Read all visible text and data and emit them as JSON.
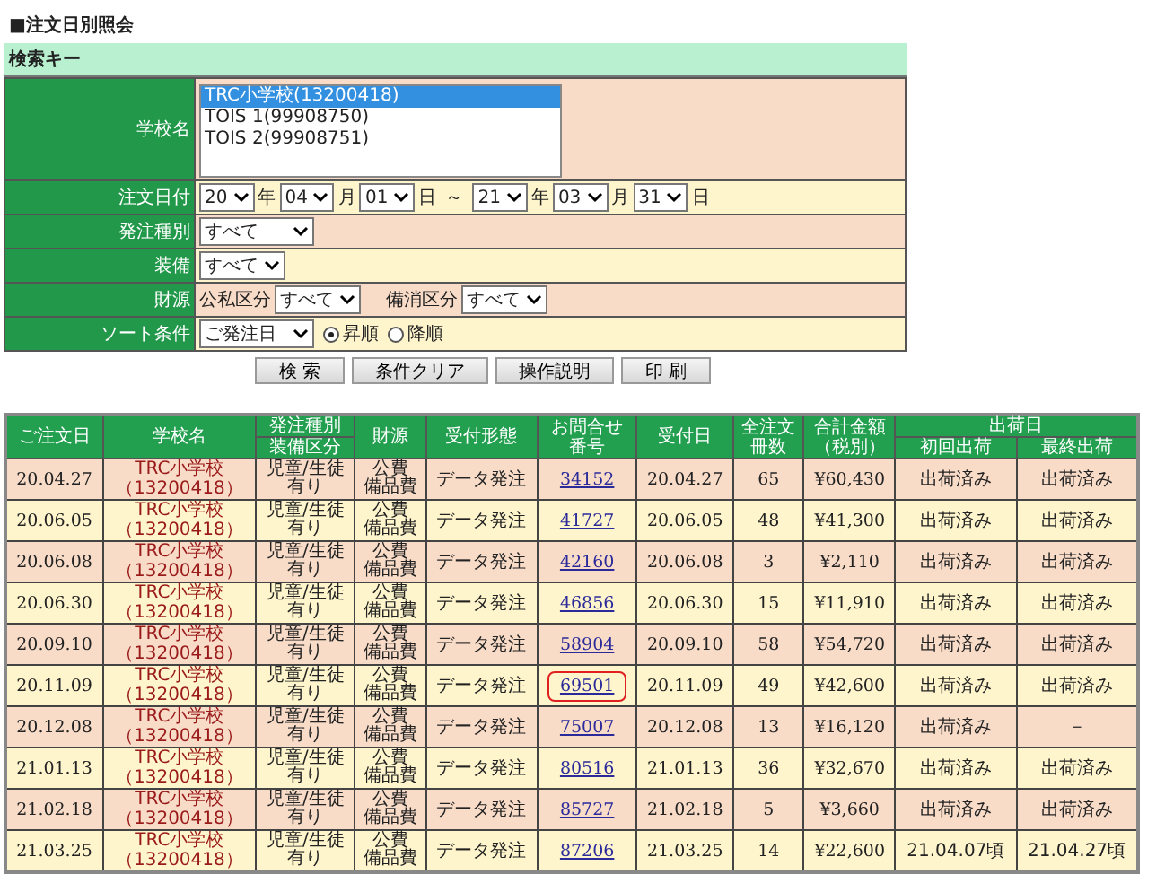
{
  "title": "■注文日別照会",
  "search_key": {
    "header": "検索キー",
    "school": {
      "label": "学校名",
      "options": [
        {
          "text": "TRC小学校(13200418)",
          "selected": true
        },
        {
          "text": "TOIS 1(99908750)",
          "selected": false
        },
        {
          "text": "TOIS 2(99908751)",
          "selected": false
        }
      ]
    },
    "date": {
      "label": "注文日付",
      "from": [
        {
          "value": "20",
          "unit": "年"
        },
        {
          "value": "04",
          "unit": "月"
        },
        {
          "value": "01",
          "unit": "日"
        }
      ],
      "separator": "～",
      "to": [
        {
          "value": "21",
          "unit": "年"
        },
        {
          "value": "03",
          "unit": "月"
        },
        {
          "value": "31",
          "unit": "日"
        }
      ]
    },
    "order_type": {
      "label": "発注種別",
      "value": "すべて"
    },
    "equipment": {
      "label": "装備",
      "value": "すべて"
    },
    "funding": {
      "label": "財源",
      "public_label": "公私区分",
      "public_value": "すべて",
      "reserve_label": "備消区分",
      "reserve_value": "すべて"
    },
    "sort": {
      "label": "ソート条件",
      "value": "ご発注日",
      "orders": [
        {
          "label": "昇順",
          "selected": true
        },
        {
          "label": "降順",
          "selected": false
        }
      ]
    }
  },
  "buttons": [
    "検 索",
    "条件クリア",
    "操作説明",
    "印 刷"
  ],
  "results": {
    "columns": [
      {
        "kind": "single",
        "lines": [
          "ご注文日"
        ]
      },
      {
        "kind": "single",
        "lines": [
          "学校名"
        ]
      },
      {
        "kind": "split",
        "top": "発注種別",
        "bottom": "装備区分"
      },
      {
        "kind": "single",
        "lines": [
          "財源"
        ]
      },
      {
        "kind": "single",
        "lines": [
          "受付形態"
        ]
      },
      {
        "kind": "single",
        "lines": [
          "お問合せ",
          "番号"
        ]
      },
      {
        "kind": "single",
        "lines": [
          "受付日"
        ]
      },
      {
        "kind": "single",
        "lines": [
          "全注文",
          "冊数"
        ]
      },
      {
        "kind": "single",
        "lines": [
          "合計金額",
          "（税別）"
        ]
      },
      {
        "kind": "group",
        "label": "出荷日",
        "sub": [
          "初回出荷",
          "最終出荷"
        ]
      }
    ],
    "rows": [
      {
        "date": "20.04.27",
        "school": [
          "TRC小学校",
          "（13200418）"
        ],
        "type": [
          "児童/生徒",
          "有り"
        ],
        "funding": [
          "公費",
          "備品費"
        ],
        "reception": "データ発注",
        "inquiry": "34152",
        "accepted": "20.04.27",
        "count": "65",
        "amount": "¥60,430",
        "first": "出荷済み",
        "last": "出荷済み",
        "highlighted": false
      },
      {
        "date": "20.06.05",
        "school": [
          "TRC小学校",
          "（13200418）"
        ],
        "type": [
          "児童/生徒",
          "有り"
        ],
        "funding": [
          "公費",
          "備品費"
        ],
        "reception": "データ発注",
        "inquiry": "41727",
        "accepted": "20.06.05",
        "count": "48",
        "amount": "¥41,300",
        "first": "出荷済み",
        "last": "出荷済み",
        "highlighted": false
      },
      {
        "date": "20.06.08",
        "school": [
          "TRC小学校",
          "（13200418）"
        ],
        "type": [
          "児童/生徒",
          "有り"
        ],
        "funding": [
          "公費",
          "備品費"
        ],
        "reception": "データ発注",
        "inquiry": "42160",
        "accepted": "20.06.08",
        "count": "3",
        "amount": "¥2,110",
        "first": "出荷済み",
        "last": "出荷済み",
        "highlighted": false
      },
      {
        "date": "20.06.30",
        "school": [
          "TRC小学校",
          "（13200418）"
        ],
        "type": [
          "児童/生徒",
          "有り"
        ],
        "funding": [
          "公費",
          "備品費"
        ],
        "reception": "データ発注",
        "inquiry": "46856",
        "accepted": "20.06.30",
        "count": "15",
        "amount": "¥11,910",
        "first": "出荷済み",
        "last": "出荷済み",
        "highlighted": false
      },
      {
        "date": "20.09.10",
        "school": [
          "TRC小学校",
          "（13200418）"
        ],
        "type": [
          "児童/生徒",
          "有り"
        ],
        "funding": [
          "公費",
          "備品費"
        ],
        "reception": "データ発注",
        "inquiry": "58904",
        "accepted": "20.09.10",
        "count": "58",
        "amount": "¥54,720",
        "first": "出荷済み",
        "last": "出荷済み",
        "highlighted": false
      },
      {
        "date": "20.11.09",
        "school": [
          "TRC小学校",
          "（13200418）"
        ],
        "type": [
          "児童/生徒",
          "有り"
        ],
        "funding": [
          "公費",
          "備品費"
        ],
        "reception": "データ発注",
        "inquiry": "69501",
        "accepted": "20.11.09",
        "count": "49",
        "amount": "¥42,600",
        "first": "出荷済み",
        "last": "出荷済み",
        "highlighted": true
      },
      {
        "date": "20.12.08",
        "school": [
          "TRC小学校",
          "（13200418）"
        ],
        "type": [
          "児童/生徒",
          "有り"
        ],
        "funding": [
          "公費",
          "備品費"
        ],
        "reception": "データ発注",
        "inquiry": "75007",
        "accepted": "20.12.08",
        "count": "13",
        "amount": "¥16,120",
        "first": "出荷済み",
        "last": "－",
        "highlighted": false
      },
      {
        "date": "21.01.13",
        "school": [
          "TRC小学校",
          "（13200418）"
        ],
        "type": [
          "児童/生徒",
          "有り"
        ],
        "funding": [
          "公費",
          "備品費"
        ],
        "reception": "データ発注",
        "inquiry": "80516",
        "accepted": "21.01.13",
        "count": "36",
        "amount": "¥32,670",
        "first": "出荷済み",
        "last": "出荷済み",
        "highlighted": false
      },
      {
        "date": "21.02.18",
        "school": [
          "TRC小学校",
          "（13200418）"
        ],
        "type": [
          "児童/生徒",
          "有り"
        ],
        "funding": [
          "公費",
          "備品費"
        ],
        "reception": "データ発注",
        "inquiry": "85727",
        "accepted": "21.02.18",
        "count": "5",
        "amount": "¥3,660",
        "first": "出荷済み",
        "last": "出荷済み",
        "highlighted": false
      },
      {
        "date": "21.03.25",
        "school": [
          "TRC小学校",
          "（13200418）"
        ],
        "type": [
          "児童/生徒",
          "有り"
        ],
        "funding": [
          "公費",
          "備品費"
        ],
        "reception": "データ発注",
        "inquiry": "87206",
        "accepted": "21.03.25",
        "count": "14",
        "amount": "¥22,600",
        "first": "21.04.07頃",
        "last": "21.04.27頃",
        "highlighted": false
      }
    ]
  }
}
